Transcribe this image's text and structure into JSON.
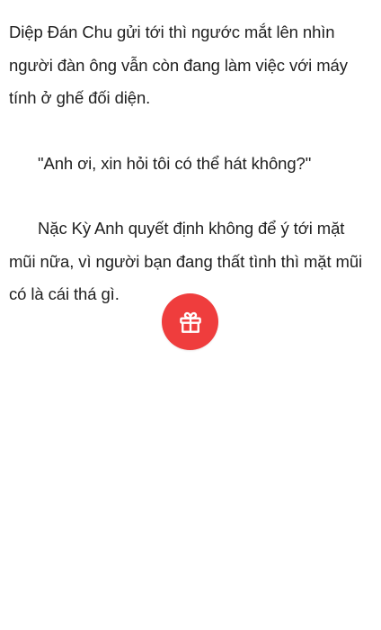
{
  "reader": {
    "paragraphs": [
      "Diệp Đán Chu gửi tới thì ngước mắt lên nhìn người đàn ông vẫn còn đang làm việc với máy tính ở ghế đối diện.",
      "\"Anh ơi, xin hỏi tôi có thể hát không?\"",
      "Nặc Kỳ Anh quyết định không để ý tới mặt mũi nữa, vì người bạn đang thất tình thì mặt mũi có là cái thá gì."
    ]
  },
  "gift_button": {
    "icon": "gift-icon",
    "background_color": "#ef3d3d",
    "icon_color": "#ffffff"
  }
}
